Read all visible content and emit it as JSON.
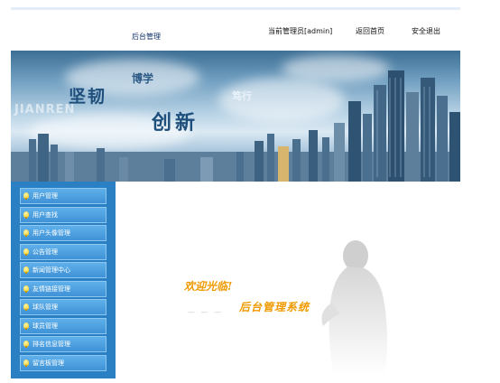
{
  "header": {
    "title": "后台管理",
    "admin_label": "当前管理员[admin]",
    "home_link": "返回首页",
    "logout_link": "安全退出"
  },
  "banner": {
    "slogan_1": "坚韧",
    "slogan_2": "博学",
    "slogan_3": "创新",
    "slogan_4": "笃行",
    "pinyin": "JIANREN"
  },
  "sidebar": {
    "items": [
      {
        "label": "用户管理",
        "icon": "bulb-icon"
      },
      {
        "label": "用户查找",
        "icon": "bulb-icon"
      },
      {
        "label": "用户头像管理",
        "icon": "bulb-icon"
      },
      {
        "label": "公告管理",
        "icon": "bulb-icon"
      },
      {
        "label": "新闻管理中心",
        "icon": "bulb-icon"
      },
      {
        "label": "友情链接管理",
        "icon": "bulb-icon"
      },
      {
        "label": "球队管理",
        "icon": "bulb-icon"
      },
      {
        "label": "球员管理",
        "icon": "bulb-icon"
      },
      {
        "label": "排名信息管理",
        "icon": "bulb-icon"
      },
      {
        "label": "留言板管理",
        "icon": "bulb-icon"
      }
    ]
  },
  "main": {
    "welcome_line1": "欢迎光临!",
    "welcome_line2": "后台管理系统",
    "dashes": "— — —"
  },
  "colors": {
    "sidebar_bg": "#2a80c3",
    "menu_item": "#4fa2e2",
    "welcome_text": "#f09a00"
  }
}
